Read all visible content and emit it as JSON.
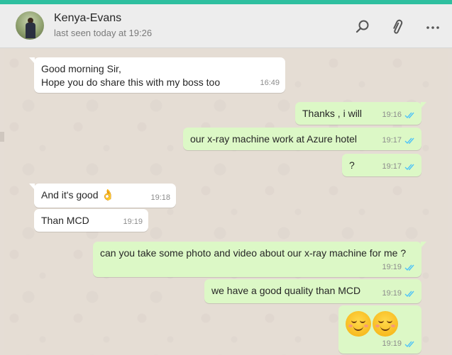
{
  "header": {
    "contact_name": "Kenya-Evans",
    "status": "last seen today at 19:26",
    "icons": [
      "search-icon",
      "paperclip-icon",
      "more-options-icon"
    ]
  },
  "colors": {
    "accent": "#2ebf9f",
    "incoming": "#ffffff",
    "outgoing": "#dcf8c6",
    "read_ticks": "#4fc3f7",
    "chat_bg": "#e5ddd5"
  },
  "messages": [
    {
      "dir": "in",
      "text": "Good morning Sir,\nHope you do share this with my boss too",
      "time": "16:49"
    },
    {
      "dir": "out",
      "text": "Thanks , i will",
      "time": "19:16",
      "status": "read"
    },
    {
      "dir": "out",
      "text": "our x-ray machine work at Azure hotel",
      "time": "19:17",
      "status": "read"
    },
    {
      "dir": "out",
      "text": "?",
      "time": "19:17",
      "status": "read"
    },
    {
      "dir": "in",
      "text": "And it's good",
      "emoji": "👌",
      "time": "19:18"
    },
    {
      "dir": "in",
      "text": "Than MCD",
      "time": "19:19"
    },
    {
      "dir": "out",
      "text": "can you take some photo and video about our x-ray machine for me ?",
      "time": "19:19",
      "status": "read"
    },
    {
      "dir": "out",
      "text": "we have a good quality than MCD",
      "time": "19:19",
      "status": "read"
    },
    {
      "dir": "out",
      "emoji_sticker": "☺☺",
      "time": "19:19",
      "status": "read"
    }
  ]
}
